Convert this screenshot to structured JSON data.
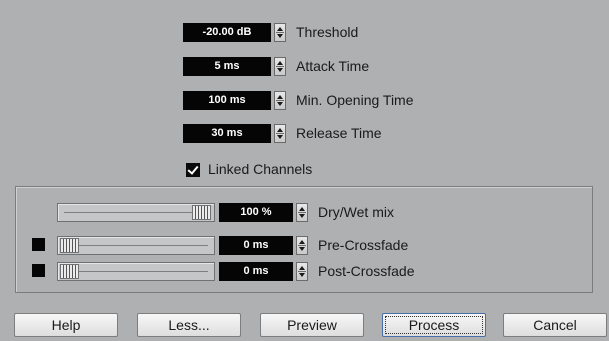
{
  "params": [
    {
      "value": "-20.00 dB",
      "label": "Threshold"
    },
    {
      "value": "5 ms",
      "label": "Attack Time"
    },
    {
      "value": "100 ms",
      "label": "Min. Opening Time"
    },
    {
      "value": "30 ms",
      "label": "Release Time"
    }
  ],
  "linked_channels": {
    "label": "Linked Channels",
    "checked": true
  },
  "mix": {
    "dry_wet": {
      "value": "100 %",
      "label": "Dry/Wet mix",
      "level_percent": 100
    },
    "pre_crossfade": {
      "value": "0 ms",
      "label": "Pre-Crossfade",
      "enabled": false,
      "level_percent": 0
    },
    "post_crossfade": {
      "value": "0 ms",
      "label": "Post-Crossfade",
      "enabled": false,
      "level_percent": 0
    }
  },
  "buttons": {
    "help": "Help",
    "less": "Less...",
    "preview": "Preview",
    "process": "Process",
    "cancel": "Cancel"
  },
  "colors": {
    "background": "#aeb0b2",
    "field": "#050505",
    "field_text": "#ffffff"
  }
}
